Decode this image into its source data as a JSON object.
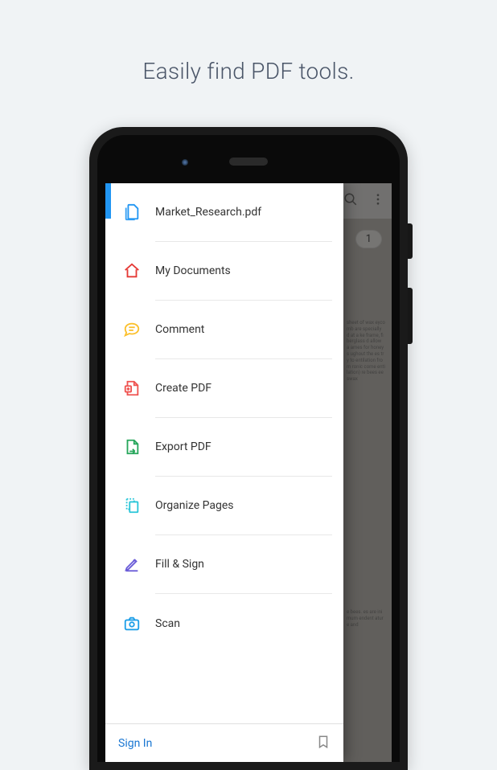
{
  "headline": "Easily find PDF tools.",
  "background": {
    "pageBadge": "1",
    "docSnippet1": "sheet of wax eycomb are specially d at a ke frame, fiberglass d allow a ames for honey s ughout the es try to entilation from ronic come entilation) re bees eeswax",
    "docSnippet2": "e bees. es are inimum endent ature and"
  },
  "drawer": {
    "items": [
      {
        "label": "Market_Research.pdf",
        "icon": "document-icon",
        "color": "#2196f3"
      },
      {
        "label": "My Documents",
        "icon": "home-icon",
        "color": "#e53935"
      },
      {
        "label": "Comment",
        "icon": "comment-icon",
        "color": "#fbc02d"
      },
      {
        "label": "Create PDF",
        "icon": "create-pdf-icon",
        "color": "#ef5350"
      },
      {
        "label": "Export PDF",
        "icon": "export-pdf-icon",
        "color": "#26a65b"
      },
      {
        "label": "Organize Pages",
        "icon": "organize-icon",
        "color": "#29c5d8"
      },
      {
        "label": "Fill & Sign",
        "icon": "sign-icon",
        "color": "#6a5cd8"
      },
      {
        "label": "Scan",
        "icon": "scan-icon",
        "color": "#1e9fe8"
      }
    ],
    "footer": {
      "signIn": "Sign In"
    }
  }
}
